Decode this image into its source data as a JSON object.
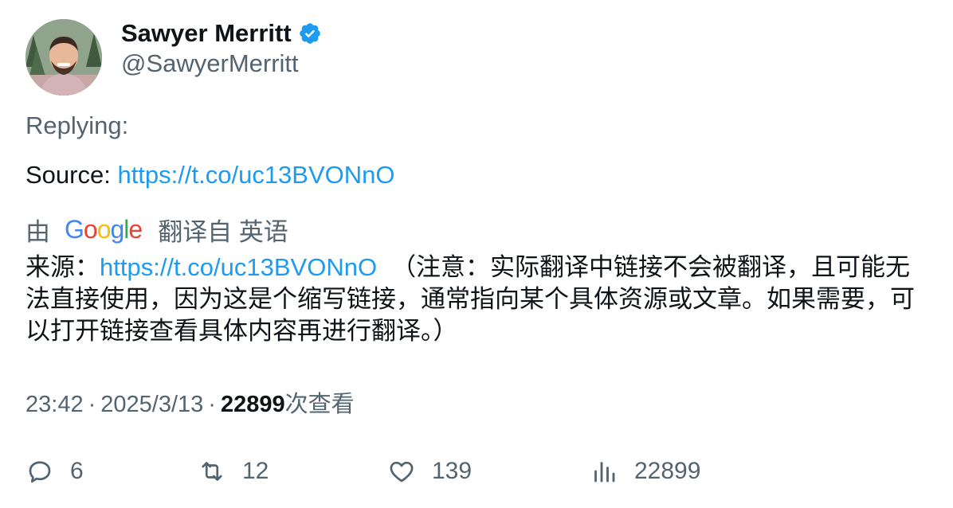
{
  "author": {
    "display_name": "Sawyer Merritt",
    "handle": "@SawyerMerritt",
    "verified_icon": "verified-badge-icon",
    "avatar_icon": "avatar-photo"
  },
  "tweet": {
    "replying_label": "Replying:",
    "source_label": "Source: ",
    "source_link": "https://t.co/uc13BVONnO"
  },
  "translation": {
    "prefix": "由",
    "google_logo": "Google",
    "suffix": "翻译自 英语",
    "text_label": "来源：",
    "text_link": "https://t.co/uc13BVONnO",
    "text_note": "（注意：实际翻译中链接不会被翻译，且可能无法直接使用，因为这是个缩写链接，通常指向某个具体资源或文章。如果需要，可以打开链接查看具体内容再进行翻译。）"
  },
  "meta": {
    "time": "23:42",
    "date": "2025/3/13",
    "separator": "·",
    "views_count": "22899",
    "views_label": "次查看"
  },
  "actions": {
    "replies": "6",
    "retweets": "12",
    "likes": "139",
    "views": "22899"
  },
  "colors": {
    "link": "#1d9bf0",
    "secondary_text": "#536471",
    "primary_text": "#0f1419"
  }
}
